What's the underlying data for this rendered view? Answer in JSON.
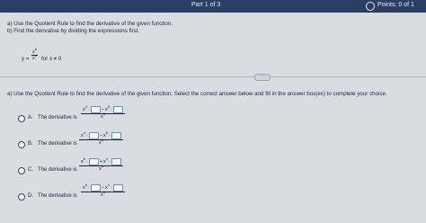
{
  "header": {
    "part": "Part 1 of 3",
    "points": "Points: 0 of 1"
  },
  "question": {
    "line_a": "a) Use the Quotient Rule to find the derivative of the given function.",
    "line_b": "b) Find the derivative by dividing the expressions first.",
    "y_prefix": "y =",
    "numerator_base": "x",
    "numerator_exp": "6",
    "denominator_base": "x",
    "denominator_exp": "4",
    "condition": "for x ≠ 0"
  },
  "divider_handle": "·····",
  "task": {
    "instruction": "a) Use the Quotient Rule to find the derivative of the given function. Select the correct answer below and fill in the answer box(es) to complete your choice."
  },
  "options": [
    {
      "letter": "A.",
      "text": "The derivative is",
      "num_left": "x",
      "num_left_exp": "4",
      "op1": "·",
      "op2": "−",
      "num_mid": "x",
      "num_mid_exp": "6",
      "den": "x",
      "den_exp": "6"
    },
    {
      "letter": "B.",
      "text": "The derivative is",
      "num_left": "x",
      "num_left_exp": "4",
      "op1": "·",
      "op2": "−",
      "num_mid": "x",
      "num_mid_exp": "6",
      "den": "x",
      "den_exp": "8"
    },
    {
      "letter": "C.",
      "text": "The derivative is",
      "num_left": "x",
      "num_left_exp": "6",
      "op1": "·",
      "op2": "+",
      "num_mid": "x",
      "num_mid_exp": "4",
      "den": "x",
      "den_exp": "8"
    },
    {
      "letter": "D.",
      "text": "The derivative is",
      "num_left": "x",
      "num_left_exp": "6",
      "op1": "·",
      "op2": "−",
      "num_mid": "x",
      "num_mid_exp": "4",
      "den": "x",
      "den_exp": "8"
    }
  ]
}
